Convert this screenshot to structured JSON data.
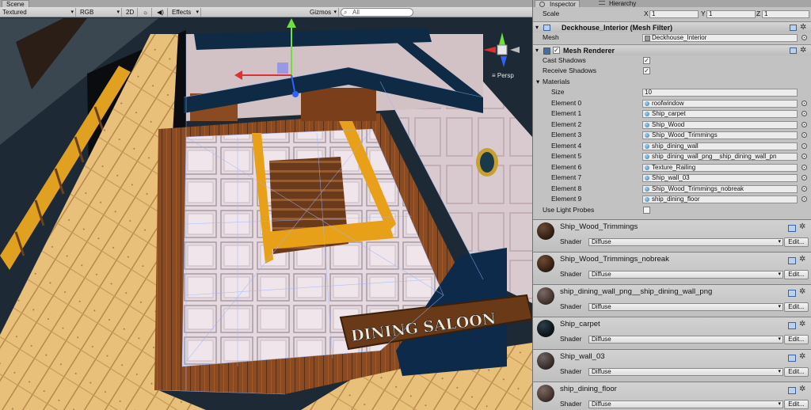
{
  "scene": {
    "tab_label": "Scene",
    "toolbar": {
      "render_mode": "Textured",
      "color_mode": "RGB",
      "mode_2d": "2D",
      "sun_icon": "sun-icon",
      "audio_icon": "speaker-icon",
      "effects": "Effects",
      "gizmos": "Gizmos",
      "search_prefix": "All"
    },
    "persp_label": "Persp",
    "sign_text": "DINING SALOON"
  },
  "inspector": {
    "tabs": [
      {
        "label": "Inspector",
        "icon": "info-icon"
      },
      {
        "label": "Hierarchy",
        "icon": "list-icon"
      }
    ],
    "scale": {
      "label": "Scale",
      "x_label": "X",
      "x": "1",
      "y_label": "Y",
      "y": "1",
      "z_label": "Z",
      "z": "1"
    },
    "mesh_filter": {
      "title": "Deckhouse_Interior (Mesh Filter)",
      "mesh_label": "Mesh",
      "mesh_value": "Deckhouse_Interior"
    },
    "mesh_renderer": {
      "title": "Mesh Renderer",
      "enabled": "✓",
      "cast_shadows_label": "Cast Shadows",
      "cast_shadows": "✓",
      "receive_shadows_label": "Receive Shadows",
      "receive_shadows": "✓",
      "materials_label": "Materials",
      "size_label": "Size",
      "size": "10",
      "elements": [
        {
          "label": "Element 0",
          "value": "roofwindow"
        },
        {
          "label": "Element 1",
          "value": "Ship_carpet"
        },
        {
          "label": "Element 2",
          "value": "Ship_Wood"
        },
        {
          "label": "Element 3",
          "value": "Ship_Wood_Trimmings"
        },
        {
          "label": "Element 4",
          "value": "ship_dining_wall"
        },
        {
          "label": "Element 5",
          "value": "ship_dining_wall_png__ship_dining_wall_pn"
        },
        {
          "label": "Element 6",
          "value": "Texture_Railing"
        },
        {
          "label": "Element 7",
          "value": "Ship_wall_03"
        },
        {
          "label": "Element 8",
          "value": "Ship_Wood_Trimmings_nobreak"
        },
        {
          "label": "Element 9",
          "value": "ship_dining_floor"
        }
      ],
      "light_probes_label": "Use Light Probes",
      "light_probes": ""
    },
    "materials": [
      {
        "name": "Ship_Wood_Trimmings",
        "shader_label": "Shader",
        "shader": "Diffuse",
        "edit": "Edit...",
        "color": "#3a2418"
      },
      {
        "name": "Ship_Wood_Trimmings_nobreak",
        "shader_label": "Shader",
        "shader": "Diffuse",
        "edit": "Edit...",
        "color": "#3d2517"
      },
      {
        "name": "ship_dining_wall_png__ship_dining_wall_png",
        "shader_label": "Shader",
        "shader": "Diffuse",
        "edit": "Edit...",
        "color": "#4a3a36"
      },
      {
        "name": "Ship_carpet",
        "shader_label": "Shader",
        "shader": "Diffuse",
        "edit": "Edit...",
        "color": "#0f1a20"
      },
      {
        "name": "Ship_wall_03",
        "shader_label": "Shader",
        "shader": "Diffuse",
        "edit": "Edit...",
        "color": "#3f3431"
      },
      {
        "name": "ship_dining_floor",
        "shader_label": "Shader",
        "shader": "Diffuse",
        "edit": "Edit...",
        "color": "#4a3a33"
      }
    ]
  }
}
